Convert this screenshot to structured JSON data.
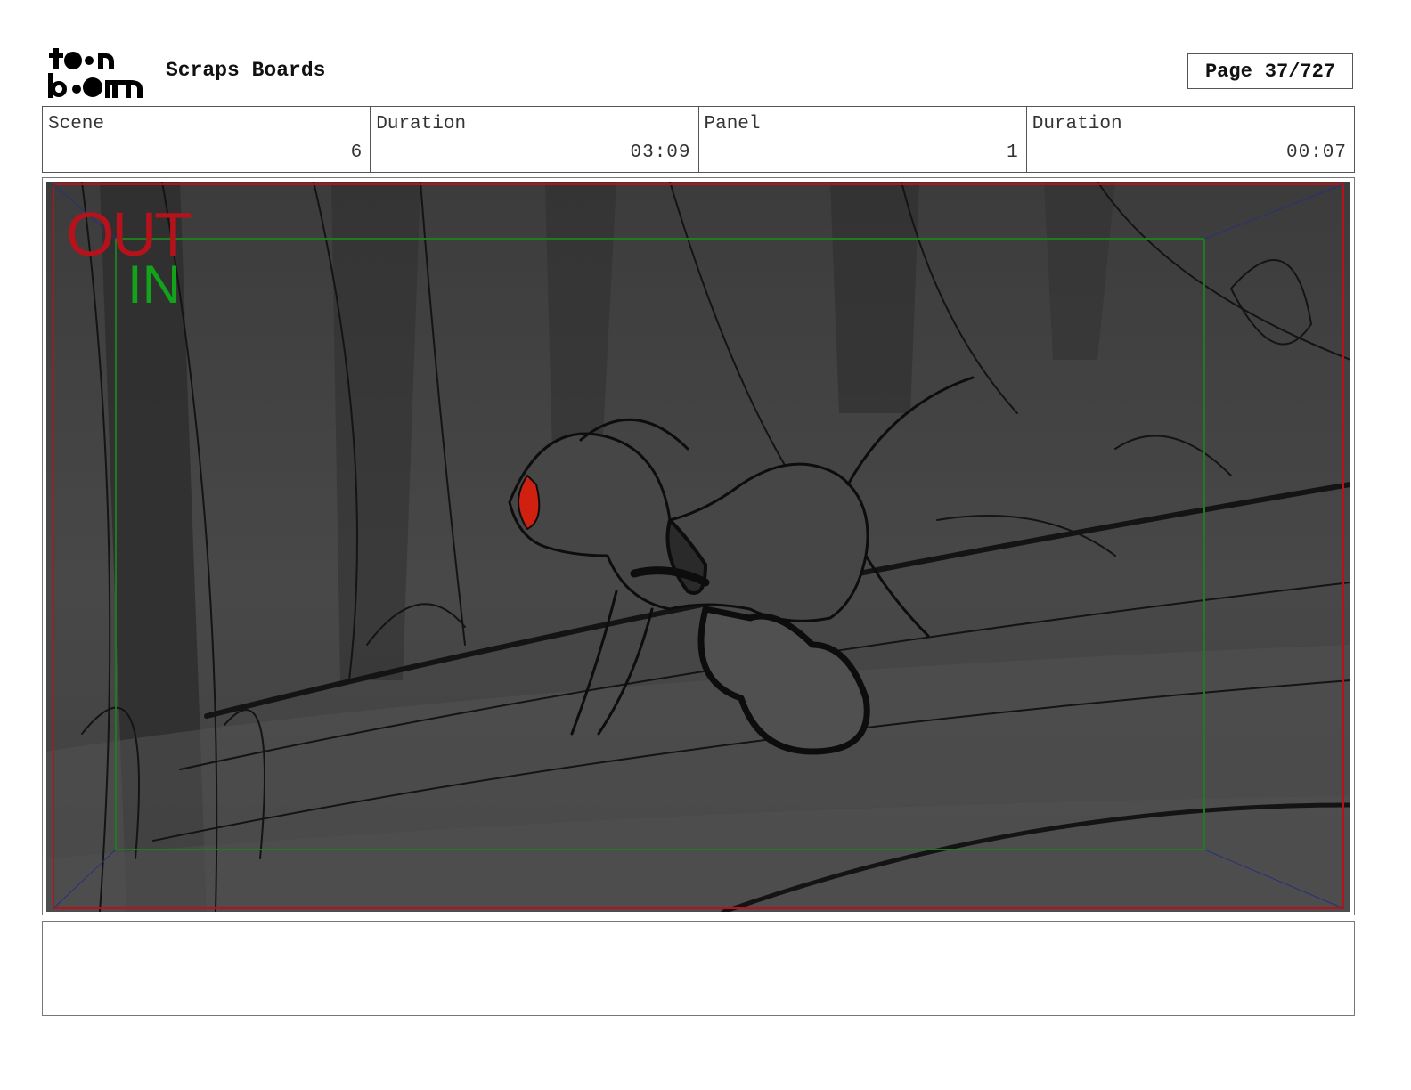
{
  "header": {
    "logo_text": "toon boom",
    "project_title": "Scraps Boards",
    "page_label": "Page",
    "page_value": "37/727"
  },
  "info": {
    "scene_label": "Scene",
    "scene_value": "6",
    "scene_duration_label": "Duration",
    "scene_duration_value": "03:09",
    "panel_label": "Panel",
    "panel_value": "1",
    "panel_duration_label": "Duration",
    "panel_duration_value": "00:07"
  },
  "panel": {
    "out_label": "OUT",
    "in_label": "IN",
    "colors": {
      "out_frame": "#b5121b",
      "in_frame": "#1f7a22",
      "background": "#4a4a4a",
      "accent_red": "#d0200f"
    }
  },
  "notes": {
    "text": ""
  }
}
